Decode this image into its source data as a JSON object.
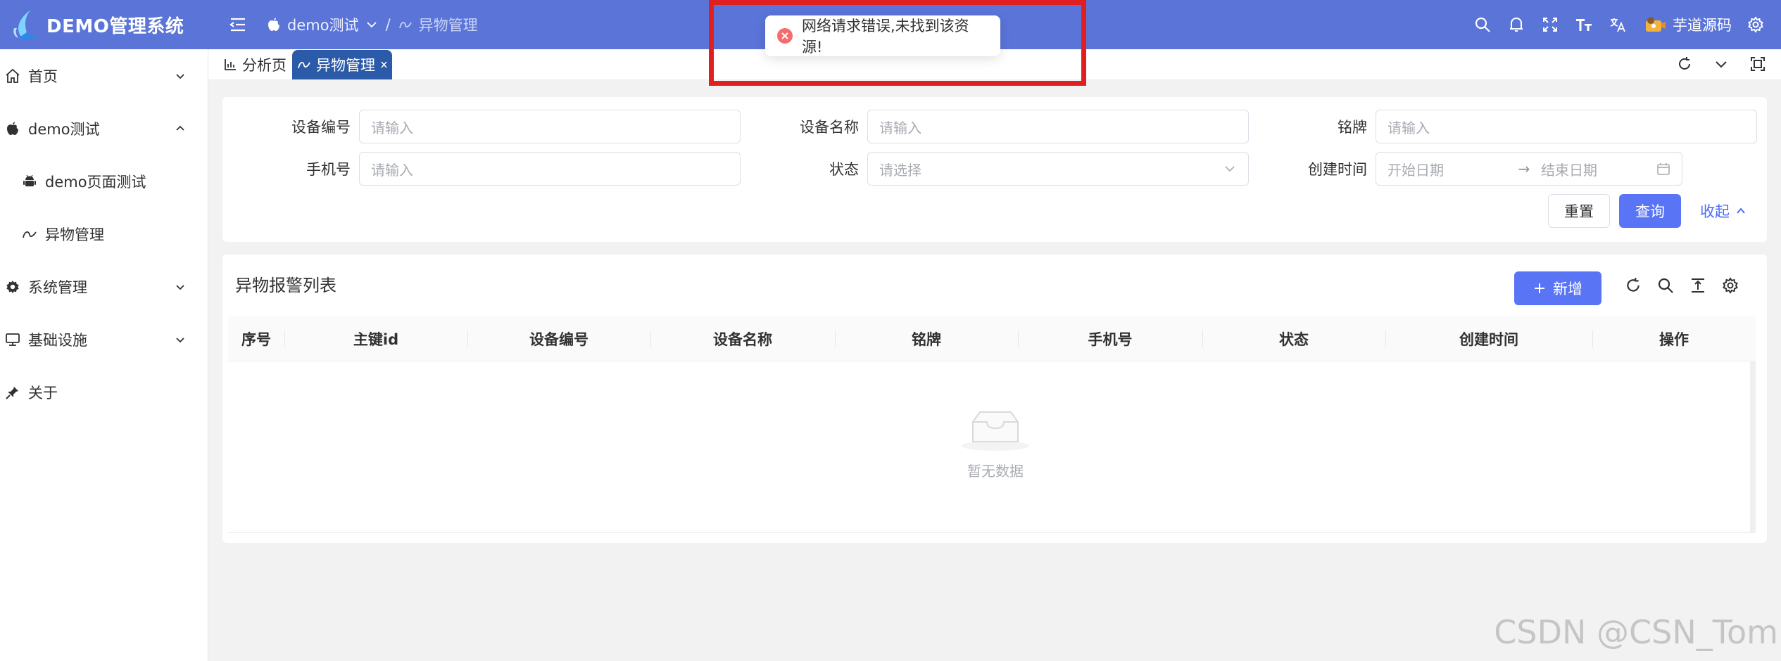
{
  "header": {
    "title": "DEMO管理系统",
    "breadcrumb": [
      {
        "label": "demo测试",
        "icon": "apple-icon"
      },
      {
        "label": "异物管理",
        "icon": "wave-icon"
      }
    ],
    "breadcrumb_separator": "/",
    "user_name": "芋道源码",
    "background": "#5a74d8"
  },
  "sidebar": {
    "items": [
      {
        "label": "首页",
        "icon": "home-icon"
      },
      {
        "label": "demo测试",
        "icon": "apple-icon"
      },
      {
        "label": "demo页面测试",
        "icon": "android-icon"
      },
      {
        "label": "异物管理",
        "icon": "wave-icon"
      },
      {
        "label": "系统管理",
        "icon": "gear-icon"
      },
      {
        "label": "基础设施",
        "icon": "monitor-icon"
      },
      {
        "label": "关于",
        "icon": "pin-icon"
      }
    ]
  },
  "tabs": [
    {
      "label": "分析页",
      "icon": "chart-icon"
    },
    {
      "label": "异物管理",
      "icon": "wave-icon",
      "active": true
    }
  ],
  "search": {
    "fields": [
      {
        "label": "设备编号",
        "placeholder": "请输入"
      },
      {
        "label": "设备名称",
        "placeholder": "请输入"
      },
      {
        "label": "铭牌",
        "placeholder": "请输入"
      },
      {
        "label": "手机号",
        "placeholder": "请输入"
      },
      {
        "label": "状态",
        "placeholder": "请选择"
      },
      {
        "label": "创建时间",
        "start_placeholder": "开始日期",
        "range_separator": "→",
        "end_placeholder": "结束日期"
      }
    ],
    "reset_label": "重置",
    "query_label": "查询",
    "collapse_label": "收起"
  },
  "table": {
    "title": "异物报警列表",
    "add_label": "新增",
    "columns": [
      "序号",
      "主键id",
      "设备编号",
      "设备名称",
      "铭牌",
      "手机号",
      "状态",
      "创建时间",
      "操作"
    ],
    "empty_text": "暂无数据"
  },
  "toast": {
    "message": "网络请求错误,未找到该资源!",
    "type": "error",
    "color": "#f56c6c"
  },
  "watermark": "CSDN @CSN_Tom",
  "colors": {
    "primary": "#5a74f6",
    "active_tab": "#2b5aa8",
    "highlight": "#e02020"
  }
}
